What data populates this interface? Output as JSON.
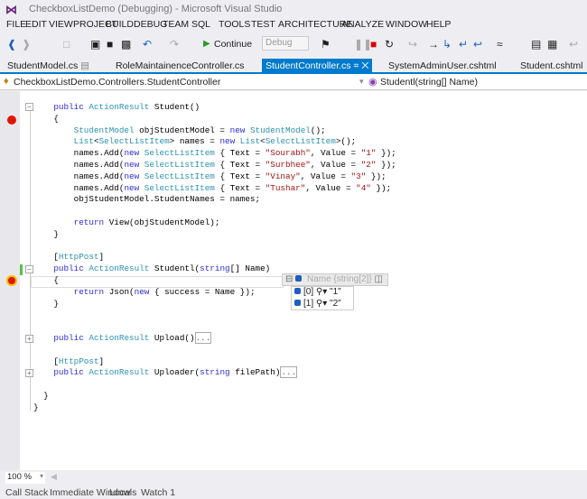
{
  "window": {
    "title": "CheckboxListDemo (Debugging) - Microsoft Visual Studio",
    "logo": "VS"
  },
  "menu": [
    "FILE",
    "EDIT",
    "VIEW",
    "PROJECT",
    "BUILD",
    "DEBUG",
    "TEAM",
    "SQL",
    "TOOLS",
    "TEST",
    "ARCHITECTURE",
    "ANALYZE",
    "WINDOW",
    "HELP"
  ],
  "toolbar": {
    "continue_label": "Continue",
    "config": "Debug",
    "icons": [
      "back-icon",
      "forward-icon",
      "new-project-icon",
      "open-icon",
      "save-icon",
      "save-all-icon",
      "undo-icon",
      "redo-icon",
      "continue-icon",
      "attach-icon",
      "break-all-icon",
      "stop-icon",
      "restart-icon",
      "show-next-icon",
      "step-into-icon",
      "step-over-icon",
      "step-out-icon",
      "hex-icon",
      "threads-icon",
      "stack-icon"
    ]
  },
  "tabs": [
    {
      "label": "StudentModel.cs"
    },
    {
      "label": "RoleMaintainenceController.cs"
    },
    {
      "label": "StudentController.cs",
      "active": true
    },
    {
      "label": "SystemAdminUser.cshtml"
    },
    {
      "label": "Student.cshtml"
    }
  ],
  "navbar": {
    "class_path": "CheckboxListDemo.Controllers.StudentController",
    "member": "Studentl(string[] Name)"
  },
  "code": [
    [
      [
        "    ",
        "pl"
      ],
      [
        "public ",
        "kw"
      ],
      [
        "ActionResult ",
        "ty"
      ],
      [
        "Student()",
        "pl"
      ]
    ],
    [
      [
        "    {",
        "pl"
      ]
    ],
    [
      [
        "        ",
        "pl"
      ],
      [
        "StudentModel ",
        "ty"
      ],
      [
        "objStudentModel = ",
        "pl"
      ],
      [
        "new ",
        "kw"
      ],
      [
        "StudentModel",
        "ty"
      ],
      [
        "();",
        "pl"
      ]
    ],
    [
      [
        "        ",
        "pl"
      ],
      [
        "List",
        "ty"
      ],
      [
        "<",
        "pl"
      ],
      [
        "SelectListItem",
        "ty"
      ],
      [
        "> names = ",
        "pl"
      ],
      [
        "new ",
        "kw"
      ],
      [
        "List",
        "ty"
      ],
      [
        "<",
        "pl"
      ],
      [
        "SelectListItem",
        "ty"
      ],
      [
        ">();",
        "pl"
      ]
    ],
    [
      [
        "        names.Add(",
        "pl"
      ],
      [
        "new ",
        "kw"
      ],
      [
        "SelectListItem",
        "ty"
      ],
      [
        " { Text = ",
        "pl"
      ],
      [
        "\"Sourabh\"",
        "st"
      ],
      [
        ", Value = ",
        "pl"
      ],
      [
        "\"1\"",
        "st"
      ],
      [
        " });",
        "pl"
      ]
    ],
    [
      [
        "        names.Add(",
        "pl"
      ],
      [
        "new ",
        "kw"
      ],
      [
        "SelectListItem",
        "ty"
      ],
      [
        " { Text = ",
        "pl"
      ],
      [
        "\"Surbhee\"",
        "st"
      ],
      [
        ", Value = ",
        "pl"
      ],
      [
        "\"2\"",
        "st"
      ],
      [
        " });",
        "pl"
      ]
    ],
    [
      [
        "        names.Add(",
        "pl"
      ],
      [
        "new ",
        "kw"
      ],
      [
        "SelectListItem",
        "ty"
      ],
      [
        " { Text = ",
        "pl"
      ],
      [
        "\"Vinay\"",
        "st"
      ],
      [
        ", Value = ",
        "pl"
      ],
      [
        "\"3\"",
        "st"
      ],
      [
        " });",
        "pl"
      ]
    ],
    [
      [
        "        names.Add(",
        "pl"
      ],
      [
        "new ",
        "kw"
      ],
      [
        "SelectListItem",
        "ty"
      ],
      [
        " { Text = ",
        "pl"
      ],
      [
        "\"Tushar\"",
        "st"
      ],
      [
        ", Value = ",
        "pl"
      ],
      [
        "\"4\"",
        "st"
      ],
      [
        " });",
        "pl"
      ]
    ],
    [
      [
        "        objStudentModel.StudentNames = names;",
        "pl"
      ]
    ],
    [],
    [
      [
        "        ",
        "pl"
      ],
      [
        "return ",
        "kw"
      ],
      [
        "View(objStudentModel);",
        "pl"
      ]
    ],
    [
      [
        "    }",
        "pl"
      ]
    ],
    [],
    [
      [
        "    [",
        "pl"
      ],
      [
        "HttpPost",
        "ty"
      ],
      [
        "]",
        "pl"
      ]
    ],
    [
      [
        "    ",
        "pl"
      ],
      [
        "public ",
        "kw"
      ],
      [
        "ActionResult ",
        "ty"
      ],
      [
        "Studentl(",
        "pl"
      ],
      [
        "string",
        "kw"
      ],
      [
        "[] Name)",
        "pl"
      ]
    ],
    [
      [
        "    {",
        "pl"
      ]
    ],
    [
      [
        "        ",
        "pl"
      ],
      [
        "return ",
        "kw"
      ],
      [
        "Json(",
        "pl"
      ],
      [
        "new ",
        "kw"
      ],
      [
        "{ success = Name });",
        "pl"
      ]
    ],
    [
      [
        "    }",
        "pl"
      ]
    ],
    [],
    [],
    [
      [
        "    ",
        "pl"
      ],
      [
        "public ",
        "kw"
      ],
      [
        "ActionResult ",
        "ty"
      ],
      [
        "Upload()",
        "pl"
      ],
      [
        "...",
        "col"
      ]
    ],
    [],
    [
      [
        "    [",
        "pl"
      ],
      [
        "HttpPost",
        "ty"
      ],
      [
        "]",
        "pl"
      ]
    ],
    [
      [
        "    ",
        "pl"
      ],
      [
        "public ",
        "kw"
      ],
      [
        "ActionResult ",
        "ty"
      ],
      [
        "Uploader(",
        "pl"
      ],
      [
        "string ",
        "kw"
      ],
      [
        "filePath)",
        "pl"
      ],
      [
        "...",
        "col"
      ]
    ],
    [],
    [
      [
        "  }",
        "pl"
      ]
    ],
    [
      [
        "}",
        "pl"
      ]
    ]
  ],
  "datatip": {
    "name": "Name",
    "type": "{string[2]}",
    "items": [
      {
        "index": "[0]",
        "value": "\"1\""
      },
      {
        "index": "[1]",
        "value": "\"2\""
      }
    ]
  },
  "zoom": "100 %",
  "bottom_tabs": [
    "Call Stack",
    "Immediate Window",
    "Locals",
    "Watch 1"
  ]
}
